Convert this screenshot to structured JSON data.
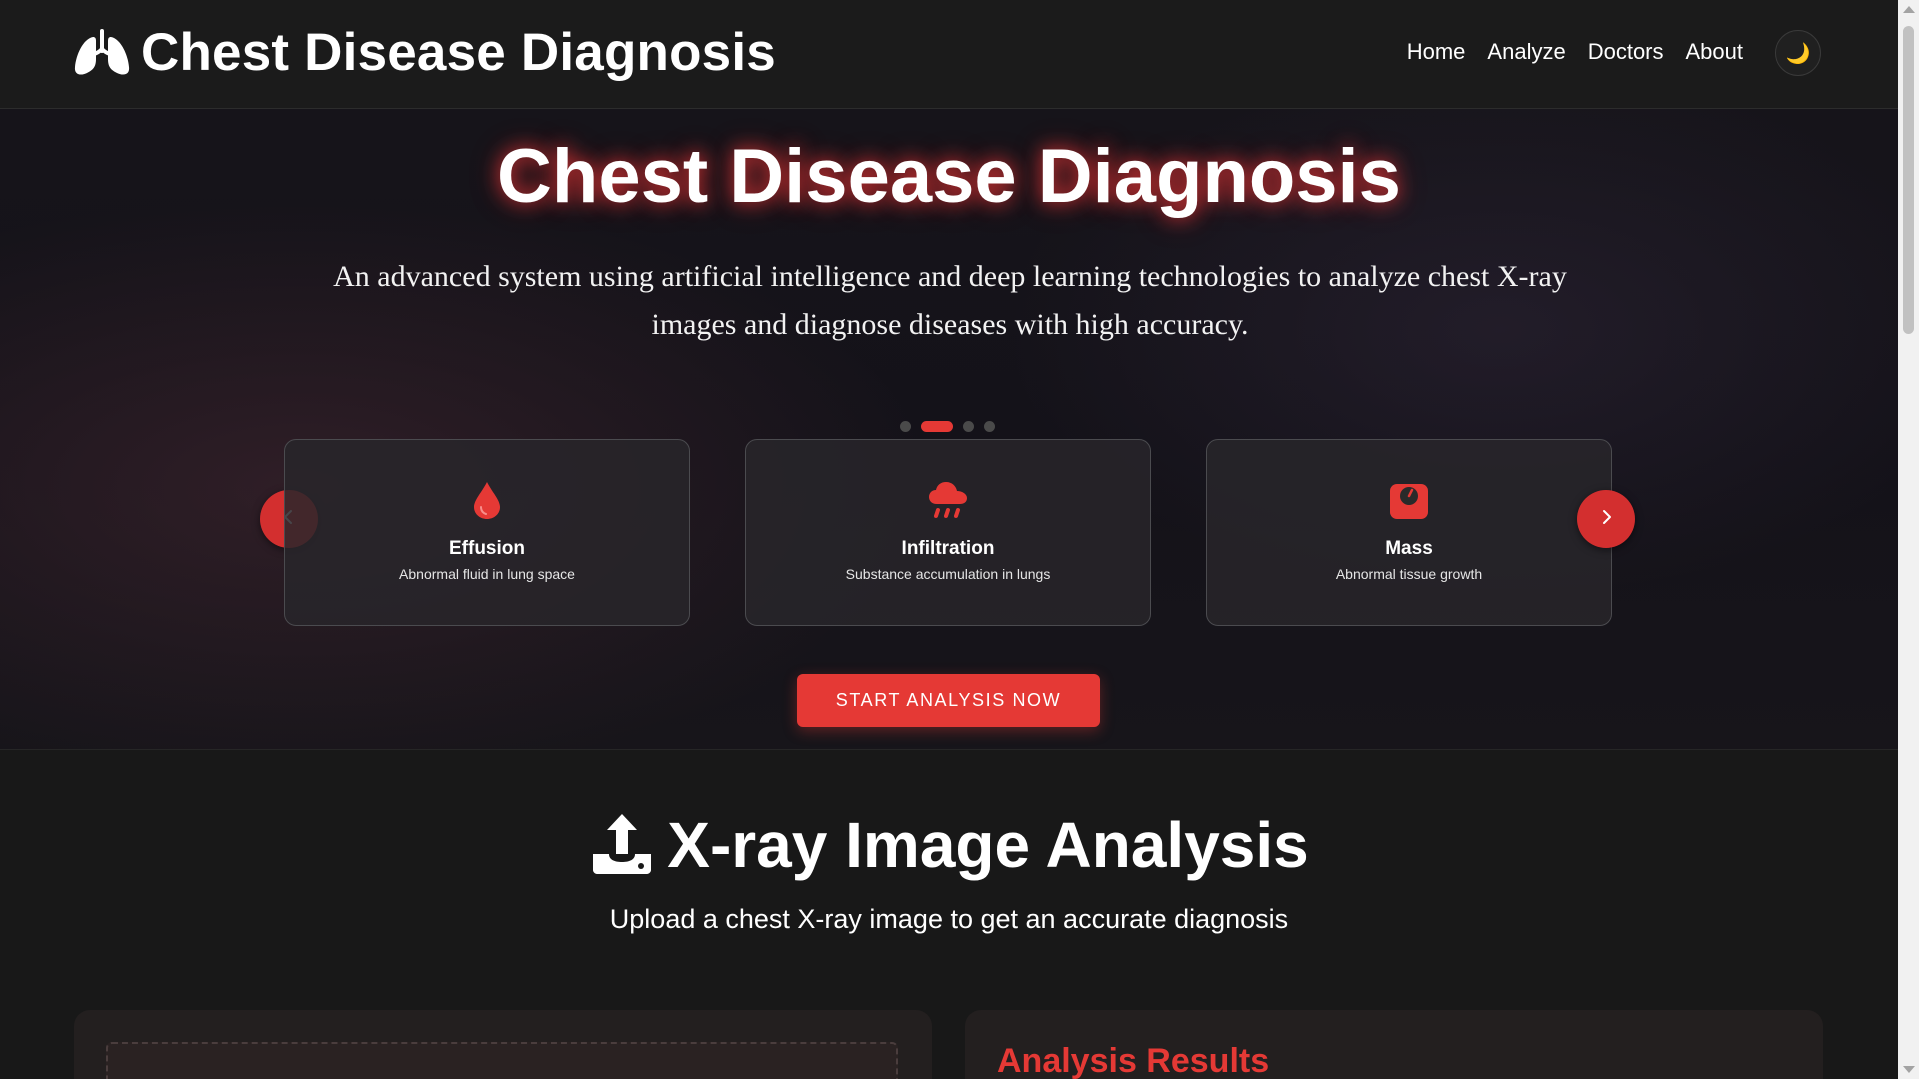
{
  "navbar": {
    "brand_title": "Chest Disease Diagnosis",
    "brand_icon": "lungs-icon",
    "links": [
      "Home",
      "Analyze",
      "Doctors",
      "About"
    ],
    "theme_icon": "moon-icon"
  },
  "hero": {
    "title": "Chest Disease Diagnosis",
    "description": "An advanced system using artificial intelligence and deep learning technologies to analyze chest X-ray images and diagnose diseases with high accuracy.",
    "carousel": {
      "dot_count": 4,
      "active_dot_index": 1,
      "cards": [
        {
          "title": "Effusion",
          "subtitle": "Abnormal fluid in lung space",
          "icon": "droplet-icon"
        },
        {
          "title": "Infiltration",
          "subtitle": "Substance accumulation in lungs",
          "icon": "cloud-rain-icon"
        },
        {
          "title": "Mass",
          "subtitle": "Abnormal tissue growth",
          "icon": "weight-scale-icon"
        }
      ],
      "prev_icon": "chevron-left-icon",
      "next_icon": "chevron-right-icon"
    },
    "cta_label": "START ANALYSIS NOW"
  },
  "analysis": {
    "title": "X-ray Image Analysis",
    "title_icon": "upload-icon",
    "subtitle": "Upload a chest X-ray image to get an accurate diagnosis",
    "results_title": "Analysis Results"
  },
  "colors": {
    "accent": "#e53935",
    "background": "#181818",
    "card_border": "#4b4b4f"
  }
}
